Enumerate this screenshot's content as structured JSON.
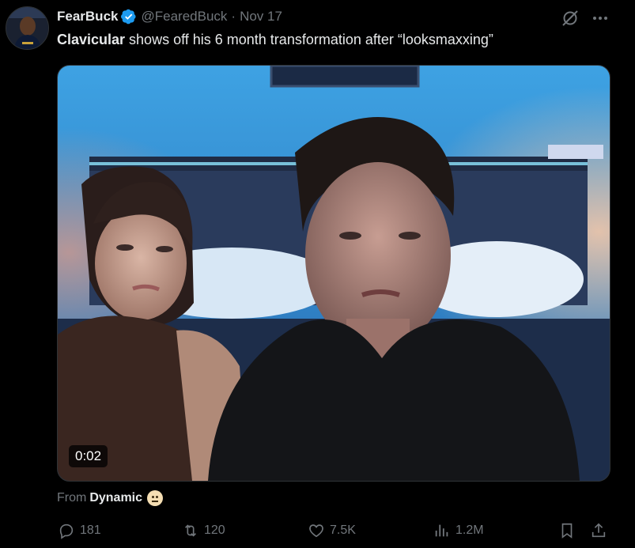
{
  "post": {
    "author": {
      "display_name": "FearBuck",
      "handle": "@FearedBuck",
      "separator": "·",
      "date": "Nov 17"
    },
    "text": {
      "bold_part": "Clavicular",
      "rest": " shows off his 6 month transformation after “looksmaxxing”"
    },
    "media": {
      "type": "video",
      "timestamp": "0:02"
    },
    "source": {
      "label": "From",
      "name": "Dynamic"
    },
    "metrics": {
      "replies": "181",
      "reposts": "120",
      "likes": "7.5K",
      "views": "1.2M"
    }
  },
  "colors": {
    "background": "#000000",
    "text_primary": "#e7e9ea",
    "text_secondary": "#71767b",
    "verified_blue": "#1d9bf0"
  },
  "icons": {
    "reply": "reply-icon",
    "repost": "repost-icon",
    "like": "like-icon",
    "views": "views-icon",
    "bookmark": "bookmark-icon",
    "share": "share-icon",
    "grok": "grok-icon",
    "more": "more-icon",
    "verified": "verified-badge-icon"
  }
}
